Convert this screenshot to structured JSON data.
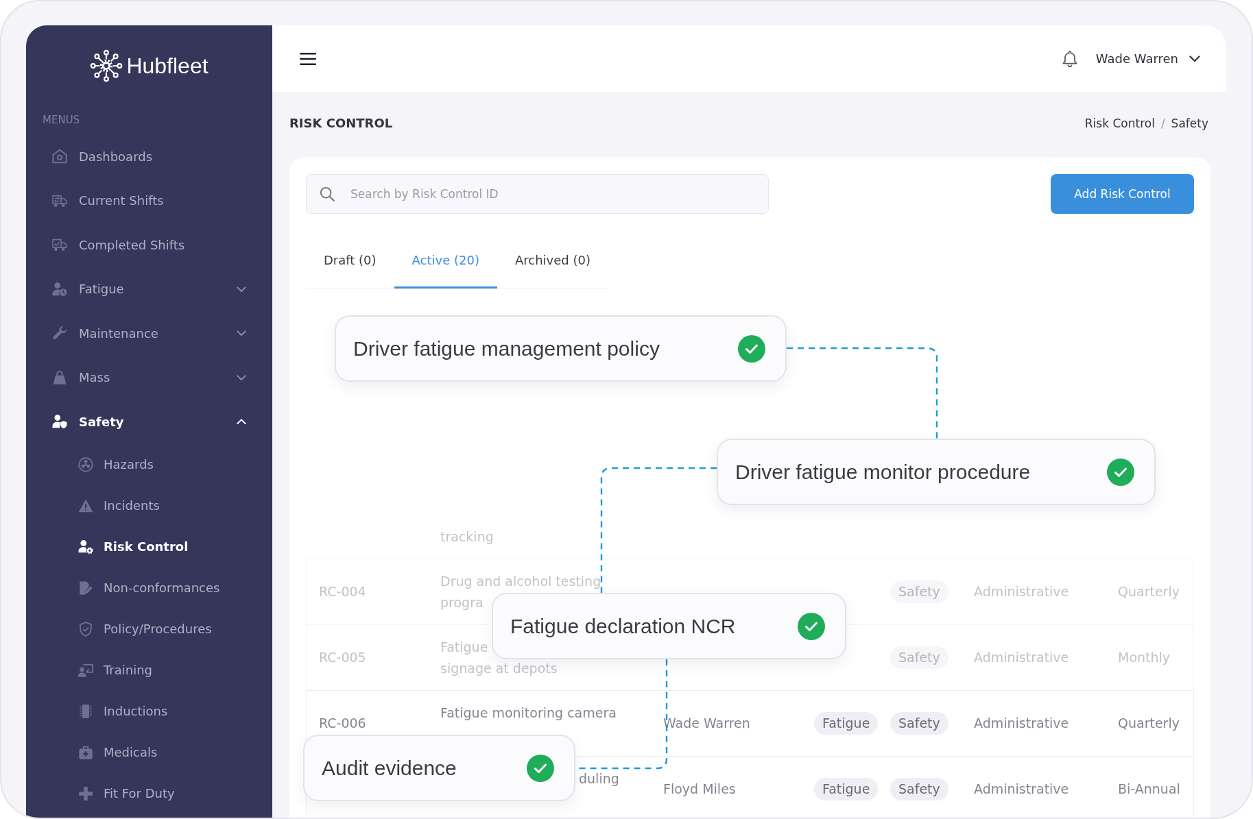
{
  "sidebar": {
    "logo": "Hubfleet",
    "section_label": "MENUS",
    "items": [
      {
        "label": "Dashboards",
        "selected": false
      },
      {
        "label": "Current Shifts",
        "selected": false
      },
      {
        "label": "Completed Shifts",
        "selected": false
      },
      {
        "label": "Fatigue",
        "selected": false,
        "expanded": false
      },
      {
        "label": "Maintenance",
        "selected": false,
        "expanded": false
      },
      {
        "label": "Mass",
        "selected": false,
        "expanded": false
      },
      {
        "label": "Safety",
        "selected": true,
        "expanded": true,
        "children": [
          {
            "label": "Hazards",
            "selected": false
          },
          {
            "label": "Incidents",
            "selected": false
          },
          {
            "label": "Risk Control",
            "selected": true
          },
          {
            "label": "Non-conformances",
            "selected": false
          },
          {
            "label": "Policy/Procedures",
            "selected": false
          },
          {
            "label": "Training",
            "selected": false
          },
          {
            "label": "Inductions",
            "selected": false
          },
          {
            "label": "Medicals",
            "selected": false
          },
          {
            "label": "Fit For Duty",
            "selected": false
          }
        ]
      }
    ]
  },
  "header": {
    "user_name": "Wade Warren"
  },
  "page": {
    "title": "RISK CONTROL",
    "breadcrumb": {
      "items": [
        "Risk Control",
        "Safety"
      ],
      "separator": "/"
    }
  },
  "toolbar": {
    "search": {
      "placeholder": "Search by Risk Control ID"
    },
    "add_button": "Add Risk Control"
  },
  "tabs": [
    {
      "label": "Draft (0)",
      "selected": false
    },
    {
      "label": "Active (20)",
      "selected": true
    },
    {
      "label": "Archived (0)",
      "selected": false
    }
  ],
  "table": {
    "rows": [
      {
        "column_2": [
          "tracking"
        ]
      },
      {
        "column_1": "RC-004",
        "column_2": [
          "Drug and alcohol testing",
          "progra"
        ],
        "column_5": "Safety",
        "column_6": "Administrative",
        "column_7": "Quarterly"
      },
      {
        "column_1": "RC-005",
        "column_2": [
          "Fatigue",
          "signage at depots"
        ],
        "column_5": "Safety",
        "column_6": "Administrative",
        "column_7": "Monthly"
      },
      {
        "column_1": "RC-006",
        "column_2": [
          "Fatigue monitoring camera"
        ],
        "column_3": "Wade Warren",
        "column_4": "Fatigue",
        "column_5": "Safety",
        "column_6": "Administrative",
        "column_7": "Quarterly"
      },
      {
        "column_2": [
          "duling"
        ],
        "column_3": "Floyd Miles",
        "column_4": "Fatigue",
        "column_5": "Safety",
        "column_6": "Administrative",
        "column_7": "Bi-Annual"
      }
    ]
  },
  "flow": {
    "nodes": [
      {
        "label": "Driver fatigue management policy",
        "complete": true
      },
      {
        "label": "Driver fatigue monitor procedure",
        "complete": true
      },
      {
        "label": "Fatigue declaration NCR",
        "complete": true
      },
      {
        "label": "Audit evidence",
        "complete": true
      }
    ]
  }
}
